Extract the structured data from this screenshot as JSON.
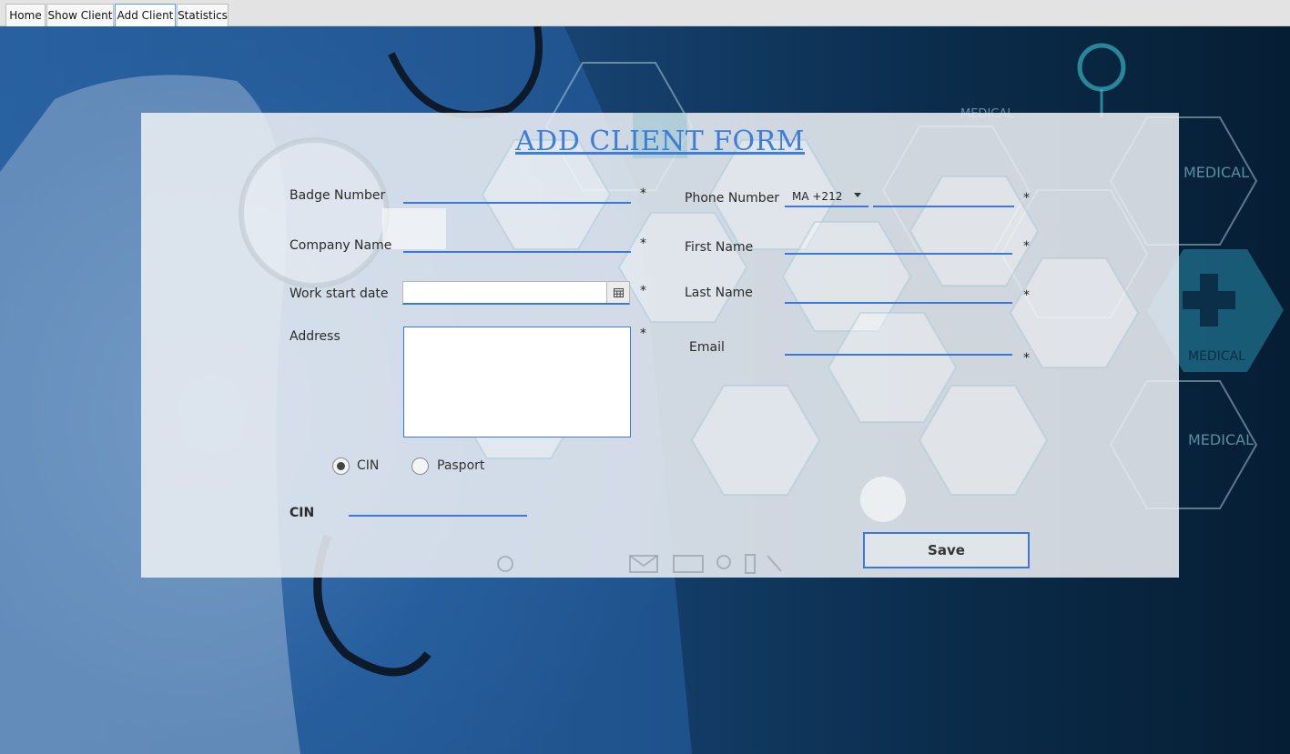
{
  "tabs": [
    {
      "label": "Home",
      "active": false
    },
    {
      "label": "Show Client",
      "active": false
    },
    {
      "label": "Add Client",
      "active": true
    },
    {
      "label": "Statistics",
      "active": false
    }
  ],
  "background": {
    "hex_labels": [
      "MEDICAL",
      "MEDICAL",
      "MEDICAL",
      "MEDICAL",
      "MEDICAL",
      "MEDICAL"
    ]
  },
  "form": {
    "title": "ADD CLIENT FORM",
    "required_marker": "*",
    "badge_number": {
      "label": "Badge Number",
      "value": ""
    },
    "company_name": {
      "label": "Company Name",
      "value": ""
    },
    "work_start_date": {
      "label": "Work start date",
      "value": ""
    },
    "address": {
      "label": "Address",
      "value": ""
    },
    "phone_number": {
      "label": "Phone Number",
      "country_code": "MA +212",
      "value": ""
    },
    "first_name": {
      "label": "First Name",
      "value": ""
    },
    "last_name": {
      "label": "Last Name",
      "value": ""
    },
    "email": {
      "label": "Email",
      "value": ""
    },
    "id_type": {
      "options": [
        {
          "label": "CIN",
          "selected": true
        },
        {
          "label": "Pasport",
          "selected": false
        }
      ]
    },
    "id_field": {
      "label": "CIN",
      "value": ""
    },
    "save_label": "Save"
  }
}
